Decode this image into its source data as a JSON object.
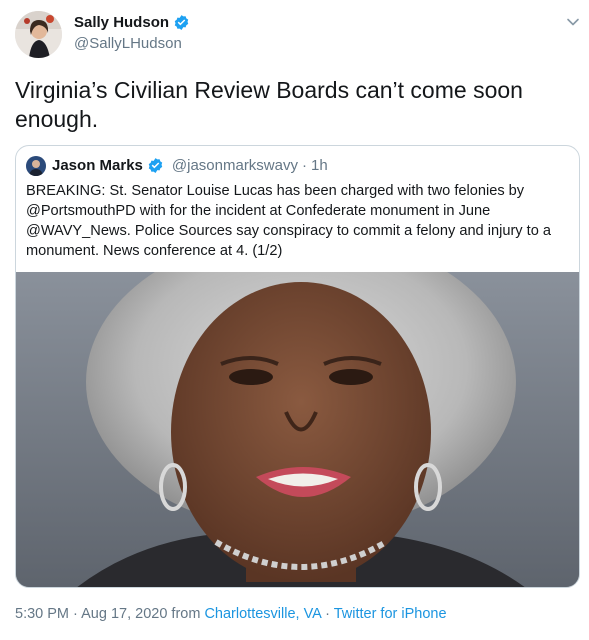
{
  "tweet": {
    "author_name": "Sally Hudson",
    "author_handle": "@SallyLHudson",
    "text": "Virginia’s Civilian Review Boards can’t come soon enough."
  },
  "quoted_tweet": {
    "author_name": "Jason Marks",
    "author_handle": "@jasonmarkswavy",
    "separator": "·",
    "time": "1h",
    "text": "BREAKING: St. Senator Louise Lucas has been charged with two felonies by @PortsmouthPD with for the incident at Confederate monument in June @WAVY_News. Police Sources say conspiracy to commit a felony and injury to a monument. News conference at 4. (1/2)"
  },
  "meta": {
    "time": "5:30 PM",
    "separator1": "·",
    "date": "Aug 17, 2020",
    "from": "from",
    "location": "Charlottesville, VA",
    "separator2": "·",
    "client": "Twitter for iPhone"
  },
  "colors": {
    "accent": "#1da1f2",
    "link": "#1b95e0",
    "secondary_text": "#657786",
    "border": "#ccd6dd"
  },
  "icons": [
    "verified-badge-icon",
    "chevron-down-icon"
  ]
}
